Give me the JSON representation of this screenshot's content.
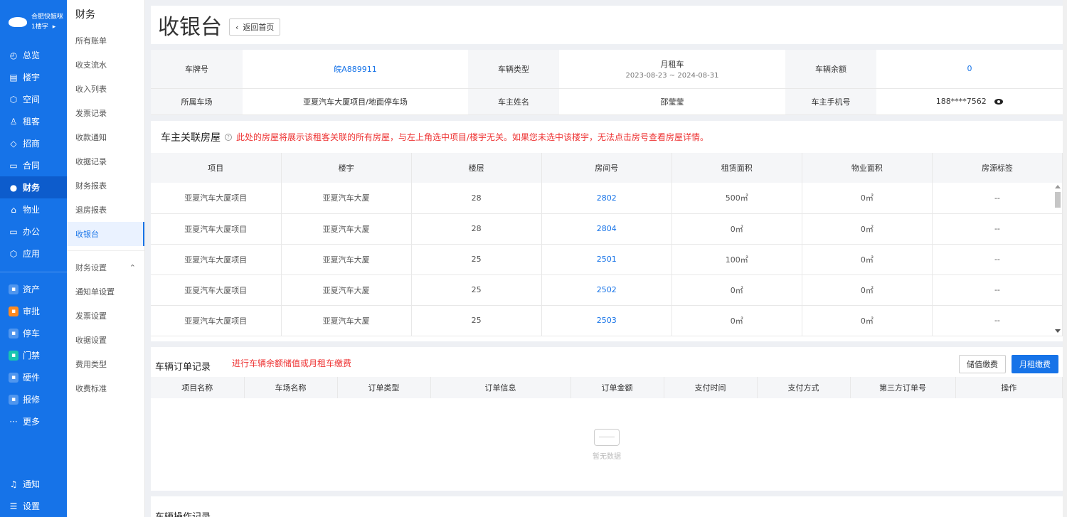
{
  "brand": {
    "name": "合肥快鲸咪",
    "building": "1楼宇"
  },
  "nav": {
    "items": [
      {
        "label": "总览",
        "icon": "dashboard-icon"
      },
      {
        "label": "楼宇",
        "icon": "building-icon"
      },
      {
        "label": "空间",
        "icon": "cube-icon"
      },
      {
        "label": "租客",
        "icon": "users-icon"
      },
      {
        "label": "招商",
        "icon": "tag-icon"
      },
      {
        "label": "合同",
        "icon": "contract-icon"
      },
      {
        "label": "财务",
        "icon": "finance-icon"
      },
      {
        "label": "物业",
        "icon": "home-icon"
      },
      {
        "label": "办公",
        "icon": "monitor-icon"
      },
      {
        "label": "应用",
        "icon": "apps-icon"
      }
    ],
    "apps": [
      {
        "label": "资产",
        "icon": "asset-icon"
      },
      {
        "label": "审批",
        "icon": "approval-icon"
      },
      {
        "label": "停车",
        "icon": "parking-icon"
      },
      {
        "label": "门禁",
        "icon": "access-icon"
      },
      {
        "label": "硬件",
        "icon": "hardware-icon"
      },
      {
        "label": "报修",
        "icon": "repair-icon"
      }
    ],
    "more": "更多",
    "notify": "通知",
    "settings": "设置"
  },
  "submenu": {
    "title": "财务",
    "items": [
      "所有账单",
      "收支流水",
      "收入列表",
      "发票记录",
      "收款通知",
      "收据记录",
      "财务报表",
      "退房报表",
      "收银台"
    ],
    "group_label": "财务设置",
    "group_items": [
      "通知单设置",
      "发票设置",
      "收据设置",
      "费用类型",
      "收费标准"
    ]
  },
  "header": {
    "title": "收银台",
    "back_label": "返回首页"
  },
  "vehicle": {
    "plate_label": "车牌号",
    "plate": "皖A889911",
    "type_label": "车辆类型",
    "type": "月租车",
    "period": "2023-08-23 ~ 2024-08-31",
    "balance_label": "车辆余额",
    "balance": "0",
    "lot_label": "所属车场",
    "lot": "亚夏汽车大厦项目/地面停车场",
    "owner_label": "车主姓名",
    "owner": "邵莹莹",
    "phone_label": "车主手机号",
    "phone": "188****7562"
  },
  "rooms": {
    "title": "车主关联房屋",
    "notice": "此处的房屋将展示该租客关联的所有房屋，与左上角选中项目/楼宇无关。如果您未选中该楼宇，无法点击房号查看房屋详情。",
    "columns": [
      "项目",
      "楼宇",
      "楼层",
      "房间号",
      "租赁面积",
      "物业面积",
      "房源标签"
    ],
    "rows": [
      [
        "亚夏汽车大厦项目",
        "亚夏汽车大厦",
        "28",
        "2802",
        "500㎡",
        "0㎡",
        "--"
      ],
      [
        "亚夏汽车大厦项目",
        "亚夏汽车大厦",
        "28",
        "2804",
        "0㎡",
        "0㎡",
        "--"
      ],
      [
        "亚夏汽车大厦项目",
        "亚夏汽车大厦",
        "25",
        "2501",
        "100㎡",
        "0㎡",
        "--"
      ],
      [
        "亚夏汽车大厦项目",
        "亚夏汽车大厦",
        "25",
        "2502",
        "0㎡",
        "0㎡",
        "--"
      ],
      [
        "亚夏汽车大厦项目",
        "亚夏汽车大厦",
        "25",
        "2503",
        "0㎡",
        "0㎡",
        "--"
      ]
    ]
  },
  "orders": {
    "title": "车辆订单记录",
    "notice": "进行车辆余额储值或月租车缴费",
    "btn_deposit": "储值缴费",
    "btn_monthly": "月租缴费",
    "columns": [
      "项目名称",
      "车场名称",
      "订单类型",
      "订单信息",
      "订单金额",
      "支付时间",
      "支付方式",
      "第三方订单号",
      "操作"
    ],
    "empty": "暂无数据"
  },
  "oplog": {
    "title": "车辆操作记录"
  }
}
